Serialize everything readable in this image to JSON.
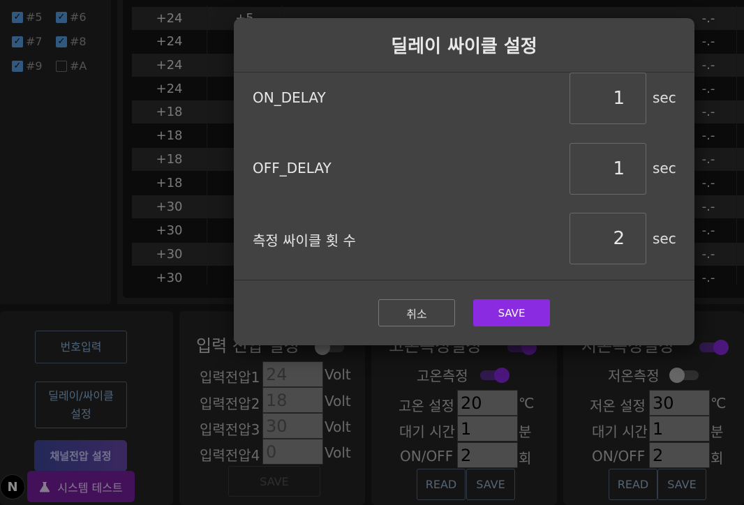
{
  "channels": [
    {
      "label": "#5",
      "checked": true
    },
    {
      "label": "#6",
      "checked": true
    },
    {
      "label": "#7",
      "checked": true
    },
    {
      "label": "#8",
      "checked": true
    },
    {
      "label": "#9",
      "checked": true
    },
    {
      "label": "#A",
      "checked": false
    }
  ],
  "table": {
    "rows": [
      {
        "voltage": "+24",
        "col2": "+5",
        "last": "-.-"
      },
      {
        "voltage": "+24",
        "col2": "",
        "last": "-.-"
      },
      {
        "voltage": "+24",
        "col2": "",
        "last": "-.-"
      },
      {
        "voltage": "+24",
        "col2": "",
        "last": "-.-"
      },
      {
        "voltage": "+18",
        "col2": "",
        "last": "-.-"
      },
      {
        "voltage": "+18",
        "col2": "",
        "last": "-.-"
      },
      {
        "voltage": "+18",
        "col2": "",
        "last": "-.-"
      },
      {
        "voltage": "+18",
        "col2": "",
        "last": "-.-"
      },
      {
        "voltage": "+30",
        "col2": "",
        "last": "-.-"
      },
      {
        "voltage": "+30",
        "col2": "",
        "last": "-.-"
      },
      {
        "voltage": "+30",
        "col2": "",
        "last": "-.-"
      },
      {
        "voltage": "+30",
        "col2": "",
        "last": "-.-"
      }
    ]
  },
  "left_buttons": {
    "number_input": "번호입력",
    "delay_cycle_line1": "딜레이/싸이클",
    "delay_cycle_line2": "설정",
    "channel_voltage": "채널전압 설정",
    "system_test": "시스템 테스트",
    "logo": "N"
  },
  "input_voltage_panel": {
    "title": "입력 전압 설정",
    "fields": [
      {
        "label": "입력전압1",
        "value": "24",
        "unit": "Volt"
      },
      {
        "label": "입력전압2",
        "value": "18",
        "unit": "Volt"
      },
      {
        "label": "입력전압3",
        "value": "30",
        "unit": "Volt"
      },
      {
        "label": "입력전압4",
        "value": "0",
        "unit": "Volt"
      }
    ],
    "save": "SAVE"
  },
  "high_temp_panel": {
    "title": "고온측정설정",
    "toggle_label": "고온측정",
    "set_label": "고온 설정",
    "set_value": "20",
    "set_unit": "℃",
    "wait_label": "대기 시간",
    "wait_value": "1",
    "wait_unit": "분",
    "onoff_label": "ON/OFF",
    "onoff_value": "2",
    "onoff_unit": "회",
    "read": "READ",
    "save": "SAVE"
  },
  "low_temp_panel": {
    "title": "저온측정설정",
    "toggle_label": "저온측정",
    "set_label": "저온 설정",
    "set_value": "30",
    "set_unit": "℃",
    "wait_label": "대기 시간",
    "wait_value": "1",
    "wait_unit": "분",
    "onoff_label": "ON/OFF",
    "onoff_value": "2",
    "onoff_unit": "회",
    "read": "READ",
    "save": "SAVE"
  },
  "modal": {
    "title": "딜레이 싸이클 설정",
    "fields": [
      {
        "label": "ON_DELAY",
        "value": "1",
        "unit": "sec"
      },
      {
        "label": "OFF_DELAY",
        "value": "1",
        "unit": "sec"
      },
      {
        "label": "측정 싸이클 횟 수",
        "value": "2",
        "unit": "sec"
      }
    ],
    "cancel": "취소",
    "save": "SAVE"
  },
  "colors": {
    "accent": "#8a2be2",
    "checkbox": "#5aa0e6",
    "system_test": "#7b1fa2"
  }
}
